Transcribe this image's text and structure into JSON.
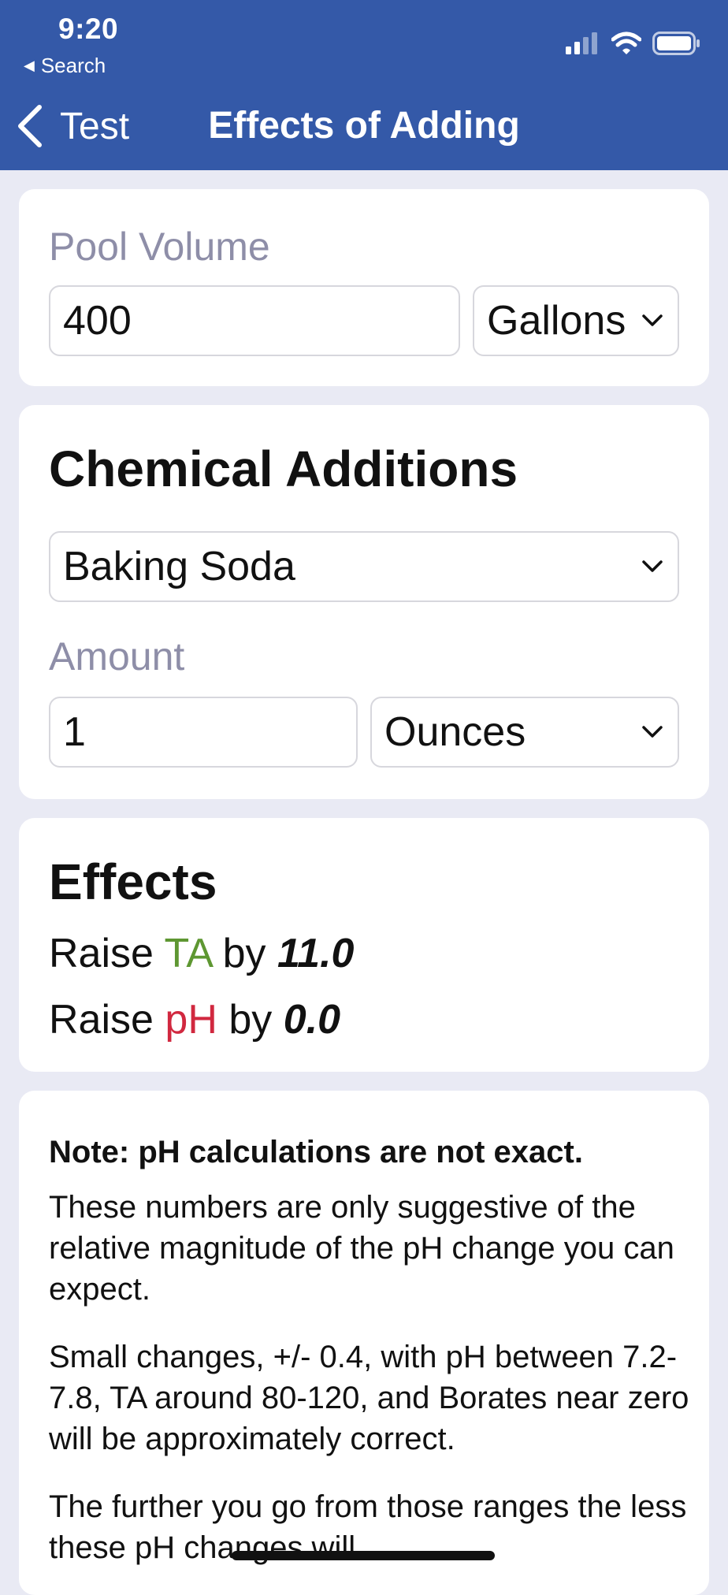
{
  "status_bar": {
    "time": "9:20",
    "back_app": "Search",
    "icons": [
      "cellular-signal-icon",
      "wifi-icon",
      "battery-icon"
    ]
  },
  "nav": {
    "back_label": "Test",
    "title": "Effects of Adding"
  },
  "pool_volume": {
    "label": "Pool Volume",
    "value": "400",
    "unit": "Gallons"
  },
  "chemical": {
    "title": "Chemical Additions",
    "selected": "Baking Soda",
    "amount_label": "Amount",
    "amount_value": "1",
    "amount_unit": "Ounces"
  },
  "effects": {
    "title": "Effects",
    "lines": [
      {
        "prefix": "Raise",
        "chem": "TA",
        "by": "by",
        "value": "11.0"
      },
      {
        "prefix": "Raise",
        "chem": "pH",
        "by": "by",
        "value": "0.0"
      }
    ]
  },
  "note": {
    "heading": "Note: pH calculations are not exact.",
    "paragraphs": [
      "These numbers are only suggestive of the relative magnitude of the pH change you can expect.",
      "Small changes, +/- 0.4, with pH between 7.2-7.8, TA around 80-120, and Borates near zero will be approximately correct.",
      "The further you go from those ranges the less these pH changes will"
    ]
  },
  "colors": {
    "header_bg": "#3459A8",
    "page_bg": "#E9EAF4",
    "ta_color": "#5E9732",
    "ph_color": "#D1283F",
    "label_gray": "#8E8EA8"
  }
}
